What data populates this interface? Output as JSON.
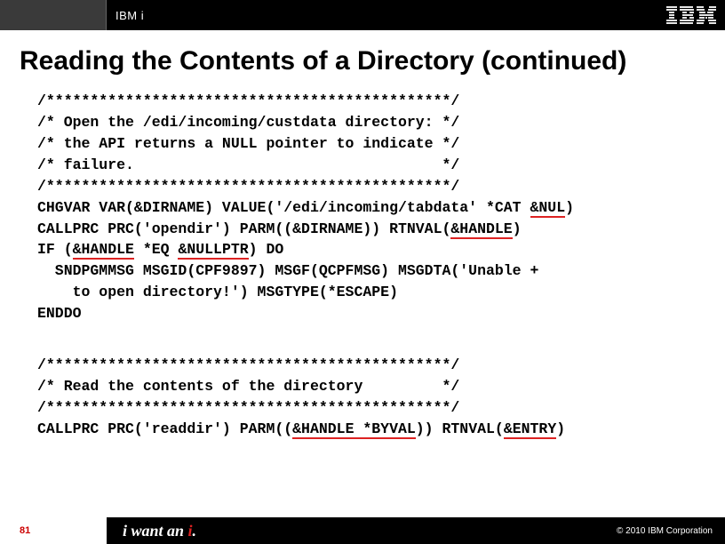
{
  "header": {
    "brand": "IBM i",
    "logo_alt": "IBM"
  },
  "title": "Reading the Contents of a Directory  (continued)",
  "code1": {
    "l1": "/**********************************************/",
    "l2": "/* Open the /edi/incoming/custdata directory: */",
    "l3": "/* the API returns a NULL pointer to indicate */",
    "l4": "/* failure.                                   */",
    "l5": "/**********************************************/",
    "l6a": "CHGVAR VAR(&DIRNAME) VALUE('/edi/incoming/tabdata' *CAT ",
    "l6b": "&NUL",
    "l6c": ")",
    "l7a": "CALLPRC PRC('opendir') PARM((&DIRNAME)) RTNVAL(",
    "l7b": "&HANDLE",
    "l7c": ")",
    "l8a": "IF (",
    "l8b": "&HANDLE",
    "l8c": " *EQ ",
    "l8d": "&NULLPTR",
    "l8e": ") DO",
    "l9": "  SNDPGMMSG MSGID(CPF9897) MSGF(QCPFMSG) MSGDTA('Unable +",
    "l10": "    to open directory!') MSGTYPE(*ESCAPE)",
    "l11": "ENDDO"
  },
  "code2": {
    "l1": "/**********************************************/",
    "l2": "/* Read the contents of the directory         */",
    "l3": "/**********************************************/",
    "l4a": "CALLPRC PRC('readdir') PARM((",
    "l4b": "&HANDLE *BYVAL",
    "l4c": ")) RTNVAL(",
    "l4d": "&ENTRY",
    "l4e": ")"
  },
  "footer": {
    "page": "81",
    "tagline_pre": "i want an ",
    "tagline_i": "i",
    "tagline_post": ".",
    "copyright": "© 2010 IBM Corporation"
  }
}
